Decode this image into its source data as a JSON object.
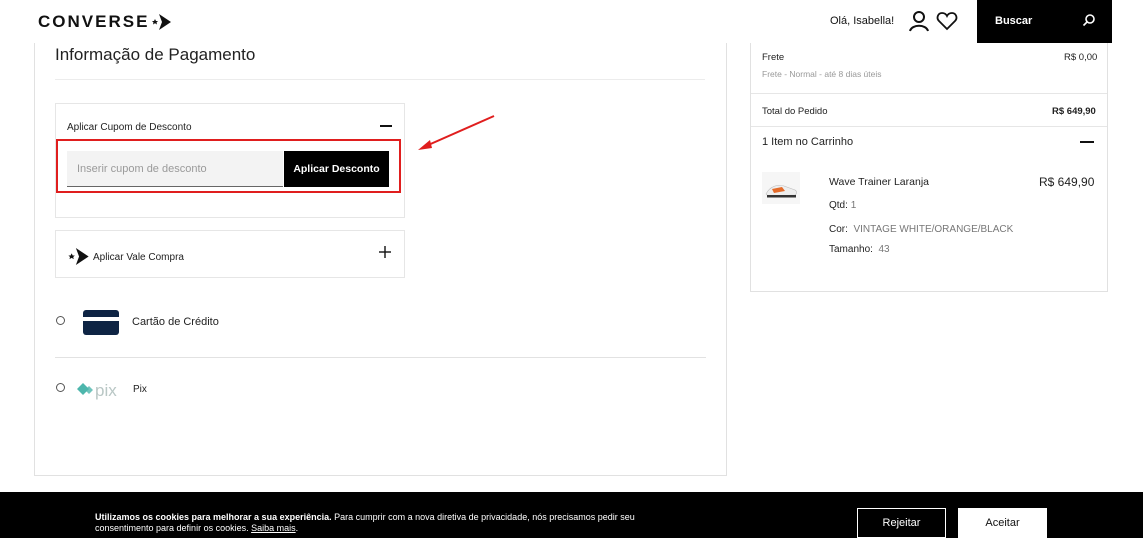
{
  "header": {
    "logo_text": "CONVERSE",
    "greeting": "Olá, Isabella!",
    "search_label": "Buscar",
    "icons": [
      "star-chevron-logo-icon",
      "user-icon",
      "heart-icon",
      "search-icon"
    ]
  },
  "payment": {
    "title": "Informação de Pagamento",
    "coupon": {
      "title": "Aplicar Cupom de Desconto",
      "placeholder": "Inserir cupom de desconto",
      "value": "",
      "button": "Aplicar Desconto",
      "toggle_icon": "minus-icon"
    },
    "voucher": {
      "label": "Aplicar Vale Compra",
      "toggle_icon": "plus-icon"
    },
    "methods": [
      {
        "label": "Cartão de Crédito",
        "icon": "credit-card-icon",
        "selected": false
      },
      {
        "label": "Pix",
        "icon": "pix-logo-icon",
        "selected": false
      }
    ]
  },
  "summary": {
    "shipping_label": "Frete",
    "shipping_value": "R$ 0,00",
    "shipping_detail": "Frete - Normal - até 8 dias úteis",
    "total_label": "Total do Pedido",
    "total_value": "R$ 649,90",
    "cart_count_label": "1 Item no Carrinho",
    "item": {
      "name": "Wave Trainer Laranja",
      "price": "R$ 649,90",
      "qty_label": "Qtd:",
      "qty_value": "1",
      "color_label": "Cor:",
      "color_value": "VINTAGE WHITE/ORANGE/BLACK",
      "size_label": "Tamanho:",
      "size_value": "43"
    }
  },
  "cookies": {
    "bold": "Utilizamos os cookies para melhorar a sua experiência.",
    "text": " Para cumprir com a nova diretiva de privacidade, nós precisamos pedir seu consentimento para definir os cookies. ",
    "link": "Saiba mais",
    "end": ".",
    "reject": "Rejeitar",
    "accept": "Aceitar"
  },
  "colors": {
    "annotation_red": "#e01e1e",
    "card_navy": "#0e2444",
    "pix_teal": "#4db6ac"
  }
}
